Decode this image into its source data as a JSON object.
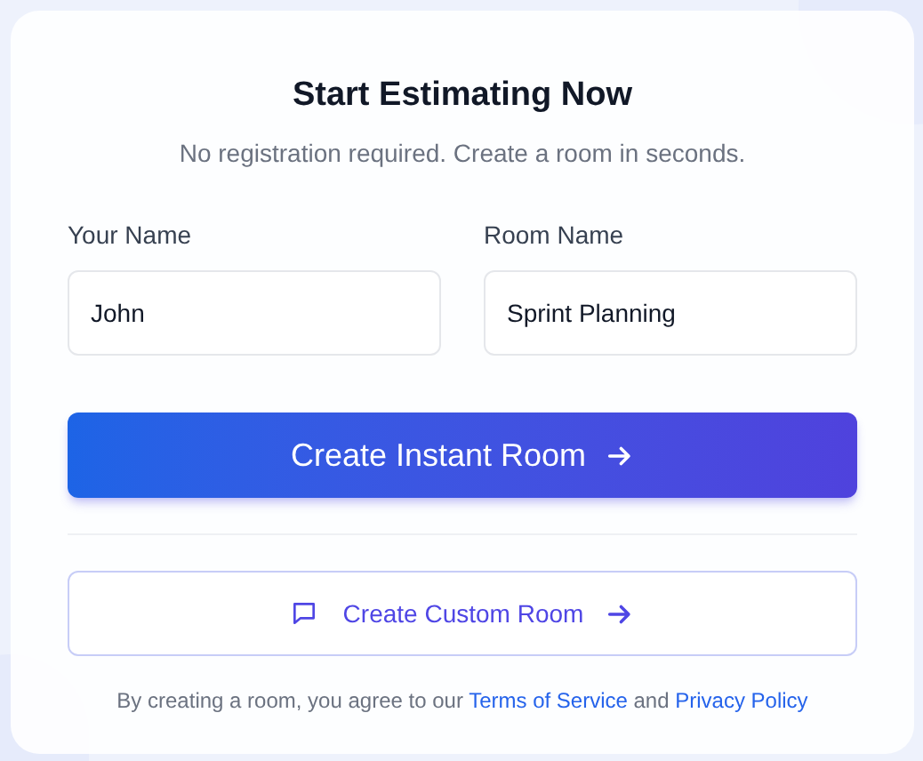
{
  "title": "Start Estimating Now",
  "subtitle": "No registration required. Create a room in seconds.",
  "fields": [
    {
      "label": "Your Name",
      "value": "John"
    },
    {
      "label": "Room Name",
      "value": "Sprint Planning"
    }
  ],
  "primary_button": {
    "label": "Create Instant Room"
  },
  "secondary_button": {
    "label": "Create Custom Room"
  },
  "legal": {
    "text": "By creating a room, you agree to our",
    "terms_link": "Terms of Service",
    "joiner": "and",
    "privacy_link": "Privacy Policy"
  }
}
